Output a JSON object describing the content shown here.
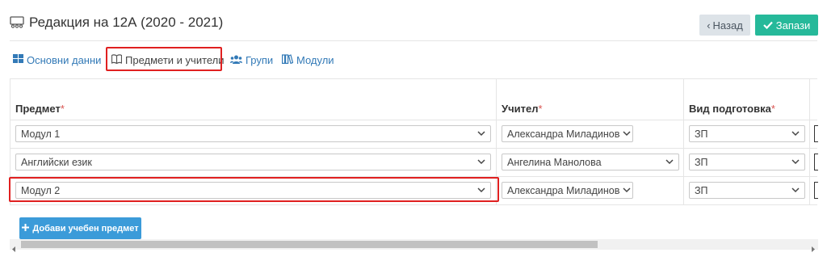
{
  "header": {
    "title": "Редакция на 12А (2020 - 2021)",
    "back_label": "Назад",
    "save_label": "Запази"
  },
  "tabs": [
    {
      "label": "Основни данни",
      "icon": "grid-icon"
    },
    {
      "label": "Предмети и учители",
      "icon": "book-icon",
      "active": true
    },
    {
      "label": "Групи",
      "icon": "users-icon"
    },
    {
      "label": "Модули",
      "icon": "books-icon"
    }
  ],
  "table": {
    "columns": [
      {
        "label": "Предмет",
        "required": "*"
      },
      {
        "label": "Учител",
        "required": "*"
      },
      {
        "label": "Вид подготовка",
        "required": "*"
      }
    ],
    "rows": [
      {
        "subject": "Модул 1",
        "teacher": "Александра Миладинова",
        "type": "ЗП"
      },
      {
        "subject": "Английски език",
        "teacher": "Ангелина Манолова",
        "type": "ЗП"
      },
      {
        "subject": "Модул 2",
        "teacher": "Александра Миладинова",
        "type": "ЗП"
      }
    ]
  },
  "add_button_label": "Добави учебен предмет",
  "colors": {
    "accent": "#26b99a",
    "primary": "#3b9bd9",
    "link": "#337ab7",
    "highlight": "#e02020"
  }
}
